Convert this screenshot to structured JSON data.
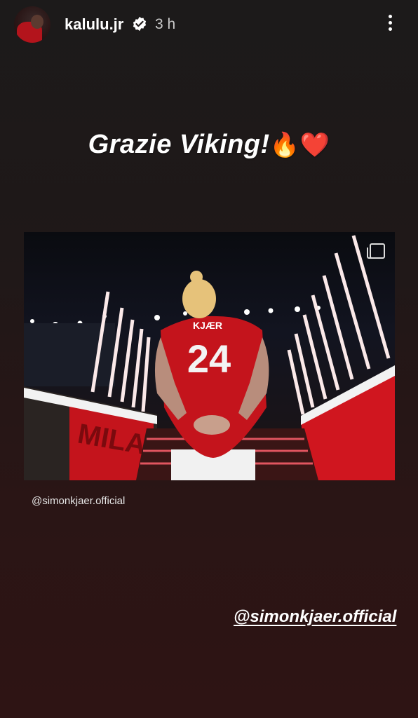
{
  "story": {
    "username": "kalulu.jr",
    "time": "3 h",
    "caption_text": "Grazie Viking!",
    "caption_emojis": "🔥❤️",
    "post_jersey_name": "KJÆR",
    "post_jersey_number": "24",
    "post_stand_text": "MILAN",
    "post_credit": "@simonkjaer.official",
    "mention": "@simonkjaer.official"
  },
  "icons": {
    "verified": "verified-badge-icon",
    "more": "more-options-icon",
    "multi": "carousel-icon"
  },
  "colors": {
    "milan_red": "#c4141c",
    "background_top": "#1c1a1a",
    "background_bottom": "#2e1414"
  }
}
